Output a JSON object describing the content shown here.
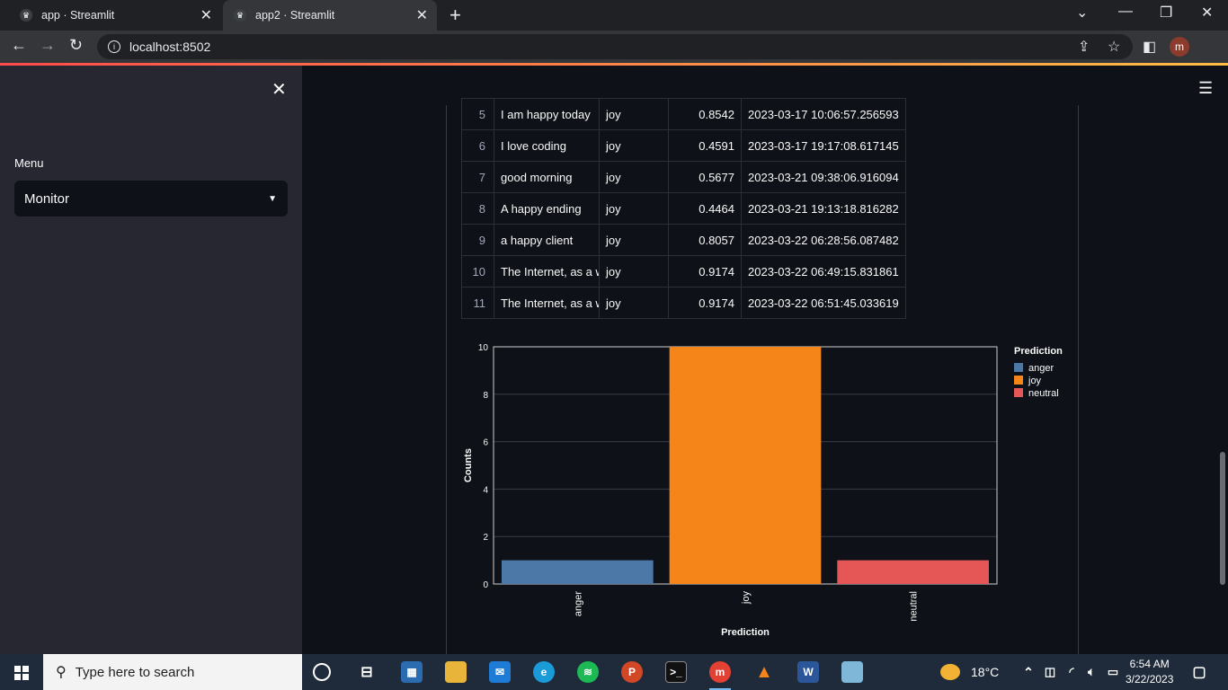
{
  "browser": {
    "tabs": [
      {
        "title": "app · Streamlit",
        "active": false
      },
      {
        "title": "app2 · Streamlit",
        "active": true
      }
    ],
    "url": "localhost:8502",
    "profile_initial": "m"
  },
  "sidebar": {
    "menu_label": "Menu",
    "menu_selected": "Monitor"
  },
  "table": {
    "rows": [
      {
        "index": "5",
        "text": "I am happy today",
        "prediction": "joy",
        "probability": "0.8542",
        "timestamp": "2023-03-17 10:06:57.256593"
      },
      {
        "index": "6",
        "text": "I love coding",
        "prediction": "joy",
        "probability": "0.4591",
        "timestamp": "2023-03-17 19:17:08.617145"
      },
      {
        "index": "7",
        "text": "good morning",
        "prediction": "joy",
        "probability": "0.5677",
        "timestamp": "2023-03-21 09:38:06.916094"
      },
      {
        "index": "8",
        "text": "A happy ending",
        "prediction": "joy",
        "probability": "0.4464",
        "timestamp": "2023-03-21 19:13:18.816282"
      },
      {
        "index": "9",
        "text": " a happy client",
        "prediction": "joy",
        "probability": "0.8057",
        "timestamp": "2023-03-22 06:28:56.087482"
      },
      {
        "index": "10",
        "text": "The Internet, as a w",
        "prediction": "joy",
        "probability": "0.9174",
        "timestamp": "2023-03-22 06:49:15.831861"
      },
      {
        "index": "11",
        "text": "The Internet, as a w",
        "prediction": "joy",
        "probability": "0.9174",
        "timestamp": "2023-03-22 06:51:45.033619"
      }
    ]
  },
  "chart_data": {
    "type": "bar",
    "categories": [
      "anger",
      "joy",
      "neutral"
    ],
    "values": [
      1,
      10,
      1
    ],
    "colors": [
      "#4c78a8",
      "#f58518",
      "#e45756"
    ],
    "xlabel": "Prediction",
    "ylabel": "Counts",
    "ylim": [
      0,
      10
    ],
    "yticks": [
      0,
      2,
      4,
      6,
      8,
      10
    ],
    "grid": true,
    "legend": {
      "title": "Prediction",
      "position": "top-right",
      "entries": [
        "anger",
        "joy",
        "neutral"
      ]
    }
  },
  "taskbar": {
    "search_placeholder": "Type here to search",
    "temperature": "18°C",
    "time": "6:54 AM",
    "date": "3/22/2023"
  }
}
